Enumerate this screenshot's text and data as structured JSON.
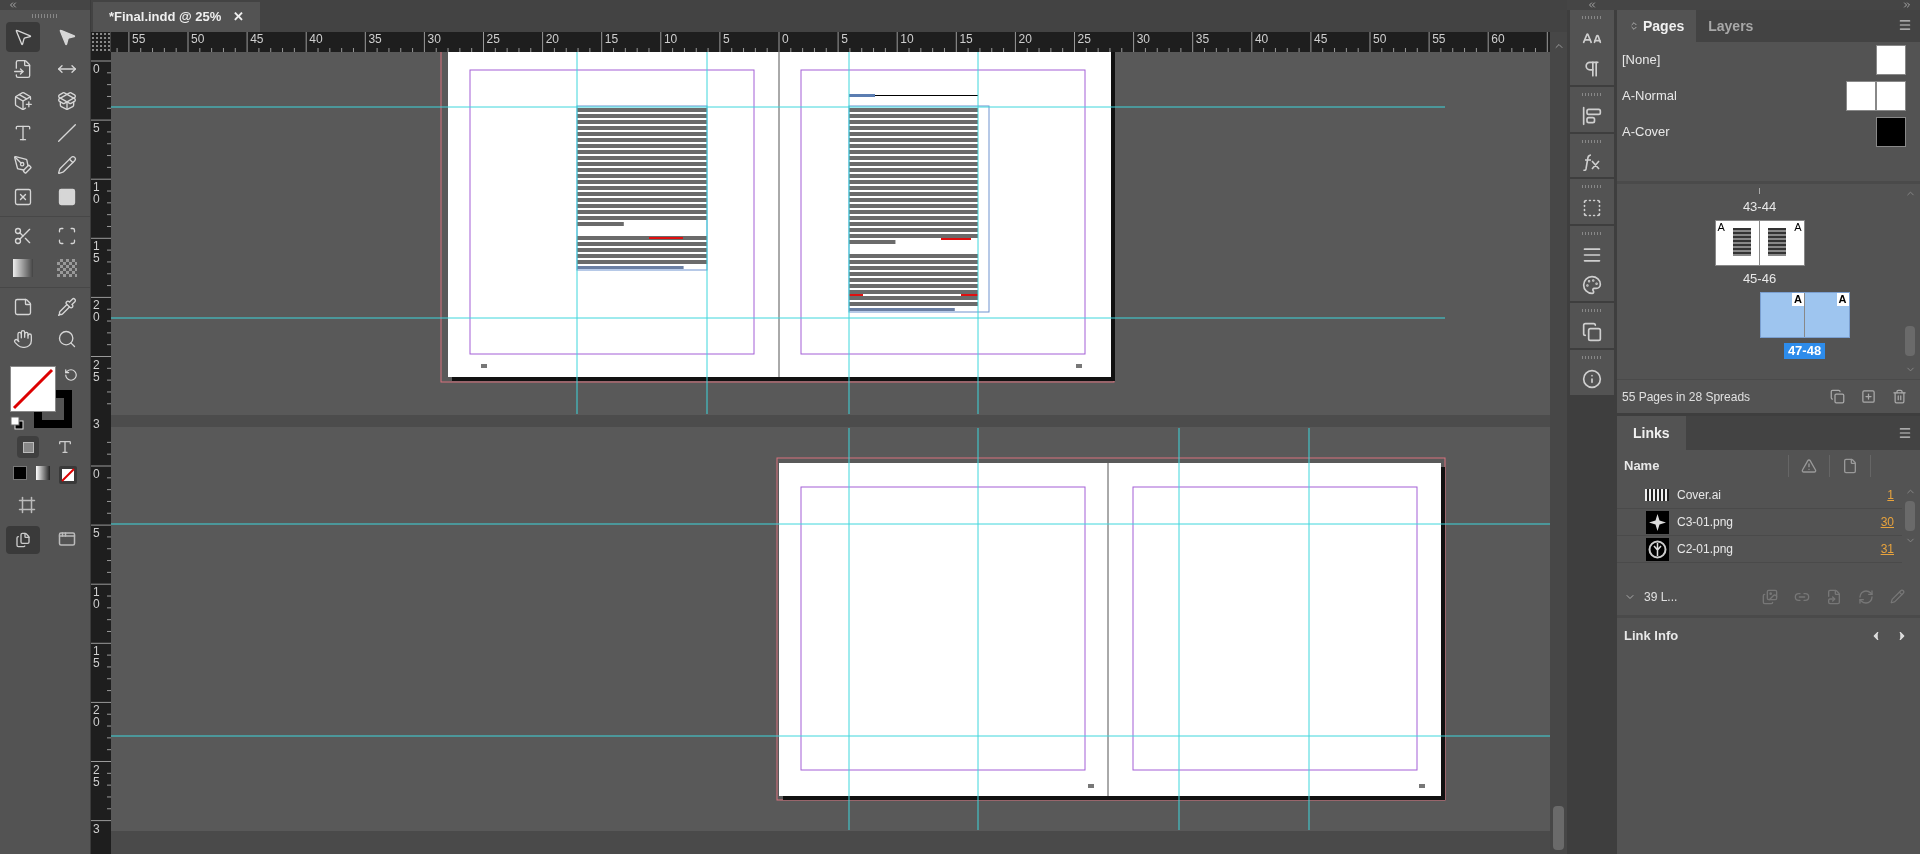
{
  "document_tab": {
    "title": "*Final.indd @ 25%",
    "close": "✕"
  },
  "ruler_horizontal": [
    "55",
    "50",
    "45",
    "40",
    "35",
    "30",
    "25",
    "20",
    "15",
    "10",
    "5",
    "0",
    "5",
    "10",
    "15",
    "20",
    "25",
    "30",
    "35",
    "40",
    "45",
    "50",
    "55",
    "60"
  ],
  "ruler_vertical_upper": [
    "0",
    "5",
    "10",
    "15",
    "20",
    "25",
    "3"
  ],
  "ruler_vertical_lower": [
    "0",
    "5",
    "10",
    "15",
    "20",
    "25",
    "3"
  ],
  "pages_panel": {
    "tabs": [
      {
        "label": "Pages",
        "selected": true
      },
      {
        "label": "Layers",
        "selected": false
      }
    ],
    "masters": [
      {
        "name": "[None]",
        "kind": "single"
      },
      {
        "name": "A-Normal",
        "kind": "spread"
      },
      {
        "name": "A-Cover",
        "kind": "dark"
      }
    ],
    "spreads": [
      {
        "label": "43-44",
        "selected": false
      },
      {
        "label": "45-46",
        "kind": "content",
        "masters": [
          "A",
          "A"
        ],
        "selected": false
      },
      {
        "label": "47-48",
        "kind": "blank",
        "masters": [
          "A",
          "A"
        ],
        "selected": true
      }
    ],
    "summary": "55 Pages in 28 Spreads"
  },
  "links_panel": {
    "title": "Links",
    "column": "Name",
    "rows": [
      {
        "name": "Cover.ai",
        "page": "1",
        "kind": "text"
      },
      {
        "name": "C3-01.png",
        "page": "30",
        "kind": "star"
      },
      {
        "name": "C2-01.png",
        "page": "31",
        "kind": "emblem"
      }
    ],
    "count": "39 L...",
    "info_title": "Link Info"
  }
}
